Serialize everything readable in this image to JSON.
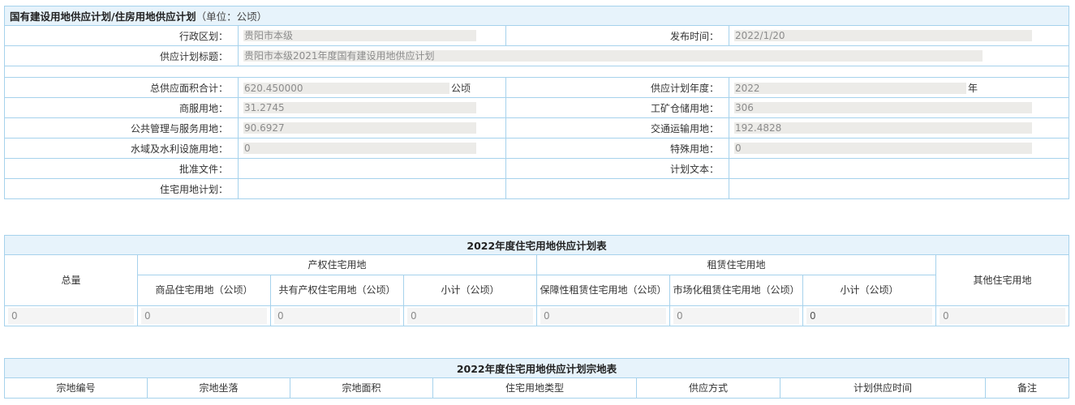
{
  "plan": {
    "title": "国有建设用地供应计划/住房用地供应计划",
    "unit_note": "（单位：公顷）",
    "district_label": "行政区划：",
    "district_value": "贵阳市本级",
    "publish_label": "发布时间：",
    "publish_value": "2022/1/20",
    "plan_title_label": "供应计划标题：",
    "plan_title_value": "贵阳市本级2021年度国有建设用地供应计划",
    "total_label": "总供应面积合计：",
    "total_value": "620.450000",
    "total_unit": "公顷",
    "year_label": "供应计划年度：",
    "year_value": "2022",
    "year_unit": "年",
    "commercial_label": "商服用地：",
    "commercial_value": "31.2745",
    "industrial_label": "工矿仓储用地：",
    "industrial_value": "306",
    "public_label": "公共管理与服务用地：",
    "public_value": "90.6927",
    "transport_label": "交通运输用地：",
    "transport_value": "192.4828",
    "water_label": "水域及水利设施用地：",
    "water_value": "0",
    "special_label": "特殊用地：",
    "special_value": "0",
    "approval_label": "批准文件：",
    "plan_text_label": "计划文本：",
    "residential_plan_label": "住宅用地计划："
  },
  "housing_table": {
    "caption": "2022年度住宅用地供应计划表",
    "total_header": "总量",
    "property_group": "产权住宅用地",
    "rental_group": "租赁住宅用地",
    "other_header": "其他住宅用地",
    "sub_headers": [
      "商品住宅用地（公顷）",
      "共有产权住宅用地（公顷）",
      "小计（公顷）",
      "保障性租赁住宅用地（公顷）",
      "市场化租赁住宅用地（公顷）",
      "小计（公顷）"
    ],
    "values": [
      "0",
      "0",
      "0",
      "0",
      "0",
      "0",
      "0",
      "0"
    ]
  },
  "parcel_table": {
    "caption": "2022年度住宅用地供应计划宗地表",
    "headers": [
      "宗地编号",
      "宗地坐落",
      "宗地面积",
      "住宅用地类型",
      "供应方式",
      "计划供应时间",
      "备注"
    ]
  },
  "colors": {
    "border": "#a6d2ec",
    "header_bg": "#e7f3fb",
    "value_bg": "#ecebe8"
  }
}
